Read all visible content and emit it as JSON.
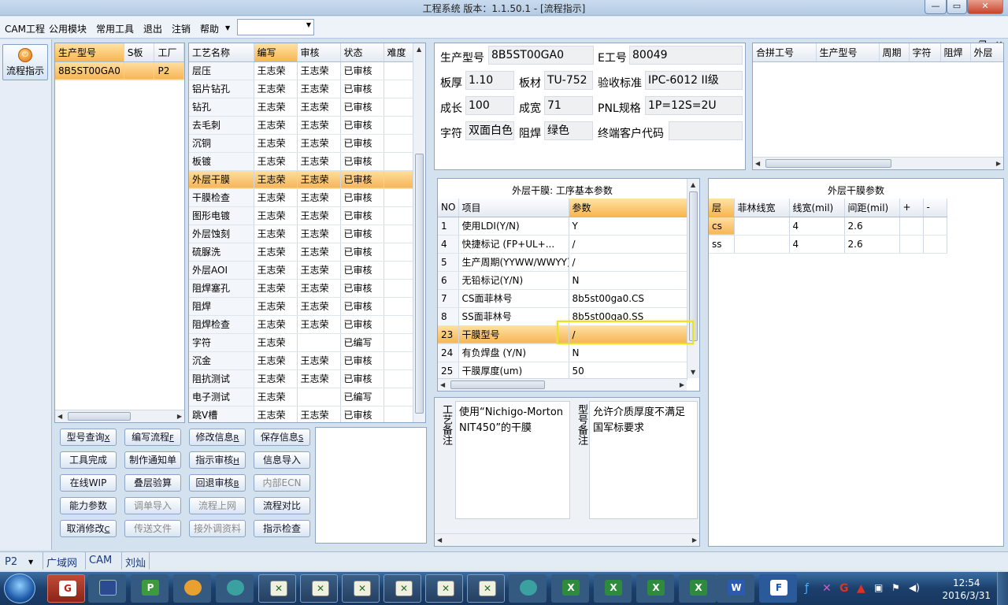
{
  "window": {
    "title": "工程系统   版本：1.1.50.1 - [流程指示]"
  },
  "menu": {
    "items": [
      "CAM工程",
      "公用模块",
      "常用工具",
      "退出",
      "注销",
      "帮助"
    ],
    "dropdown_value": ""
  },
  "leftbar": {
    "flow_label": "流程指示"
  },
  "product_table": {
    "headers": [
      "生产型号",
      "S板",
      "工厂"
    ],
    "rows": [
      [
        "8B5ST00GA0",
        "",
        "P2"
      ]
    ]
  },
  "process_table": {
    "headers": [
      "工艺名称",
      "编写",
      "审核",
      "状态",
      "难度"
    ],
    "rows": [
      [
        "层压",
        "王志荣",
        "王志荣",
        "已审核",
        ""
      ],
      [
        "铝片钻孔",
        "王志荣",
        "王志荣",
        "已审核",
        ""
      ],
      [
        "钻孔",
        "王志荣",
        "王志荣",
        "已审核",
        ""
      ],
      [
        "去毛刺",
        "王志荣",
        "王志荣",
        "已审核",
        ""
      ],
      [
        "沉铜",
        "王志荣",
        "王志荣",
        "已审核",
        ""
      ],
      [
        "板镀",
        "王志荣",
        "王志荣",
        "已审核",
        ""
      ],
      [
        "外层干膜",
        "王志荣",
        "王志荣",
        "已审核",
        ""
      ],
      [
        "干膜检查",
        "王志荣",
        "王志荣",
        "已审核",
        ""
      ],
      [
        "图形电镀",
        "王志荣",
        "王志荣",
        "已审核",
        ""
      ],
      [
        "外层蚀刻",
        "王志荣",
        "王志荣",
        "已审核",
        ""
      ],
      [
        "硫脲洗",
        "王志荣",
        "王志荣",
        "已审核",
        ""
      ],
      [
        "外层AOI",
        "王志荣",
        "王志荣",
        "已审核",
        ""
      ],
      [
        "阻焊塞孔",
        "王志荣",
        "王志荣",
        "已审核",
        ""
      ],
      [
        "阻焊",
        "王志荣",
        "王志荣",
        "已审核",
        ""
      ],
      [
        "阻焊检查",
        "王志荣",
        "王志荣",
        "已审核",
        ""
      ],
      [
        "字符",
        "王志荣",
        "",
        "已编写",
        ""
      ],
      [
        "沉金",
        "王志荣",
        "王志荣",
        "已审核",
        ""
      ],
      [
        "阻抗测试",
        "王志荣",
        "王志荣",
        "已审核",
        ""
      ],
      [
        "电子测试",
        "王志荣",
        "",
        "已编写",
        ""
      ],
      [
        "跳V槽",
        "王志荣",
        "王志荣",
        "已审核",
        ""
      ]
    ]
  },
  "buttons": [
    [
      {
        "label": "型号查询",
        "key": "X",
        "enabled": true
      },
      {
        "label": "编写流程",
        "key": "F",
        "enabled": true
      },
      {
        "label": "修改信息",
        "key": "R",
        "enabled": true
      },
      {
        "label": "保存信息",
        "key": "S",
        "enabled": true
      }
    ],
    [
      {
        "label": "工具完成",
        "key": "",
        "enabled": true
      },
      {
        "label": "制作通知单",
        "key": "",
        "enabled": true
      },
      {
        "label": "指示审核",
        "key": "H",
        "enabled": true
      },
      {
        "label": "信息导入",
        "key": "",
        "enabled": true
      }
    ],
    [
      {
        "label": "在线WIP",
        "key": "",
        "enabled": true
      },
      {
        "label": "叠层验算",
        "key": "",
        "enabled": true
      },
      {
        "label": "回退审核",
        "key": "B",
        "enabled": true
      },
      {
        "label": "内部ECN",
        "key": "",
        "enabled": false
      }
    ],
    [
      {
        "label": "能力参数",
        "key": "",
        "enabled": true
      },
      {
        "label": "调单导入",
        "key": "",
        "enabled": false
      },
      {
        "label": "流程上网",
        "key": "",
        "enabled": false
      },
      {
        "label": "流程对比",
        "key": "",
        "enabled": true
      }
    ],
    [
      {
        "label": "取消修改",
        "key": "C",
        "enabled": true
      },
      {
        "label": "传送文件",
        "key": "",
        "enabled": false
      },
      {
        "label": "接外调资料",
        "key": "",
        "enabled": false
      },
      {
        "label": "指示检查",
        "key": "",
        "enabled": true
      }
    ]
  ],
  "info": {
    "model_label": "生产型号",
    "model_value": "8B5ST00GA0",
    "e_label": "E工号",
    "e_value": "80049",
    "thick_label": "板厚",
    "thick_value": "1.10",
    "material_label": "板材",
    "material_value": "TU-752",
    "std_label": "验收标准",
    "std_value": "IPC-6012 II级",
    "len_label": "成长",
    "len_value": "100",
    "wid_label": "成宽",
    "wid_value": "71",
    "pnl_label": "PNL规格",
    "pnl_value": "1P=12S=2U",
    "char_label": "字符",
    "char_value": "双面白色",
    "mask_label": "阻焊",
    "mask_value": "绿色",
    "cust_label": "终端客户代码",
    "cust_value": ""
  },
  "combine_table": {
    "headers": [
      "合拼工号",
      "生产型号",
      "周期",
      "字符",
      "阻焊",
      "外层"
    ]
  },
  "params": {
    "title": "外层干膜: 工序基本参数",
    "headers": [
      "NO",
      "项目",
      "参数"
    ],
    "rows": [
      [
        "1",
        "使用LDI(Y/N)",
        "Y"
      ],
      [
        "4",
        "快捷标记 (FP+UL+...",
        "/"
      ],
      [
        "5",
        "生产周期(YYWW/WWYY)",
        "/"
      ],
      [
        "6",
        "无铅标记(Y/N)",
        "N"
      ],
      [
        "7",
        "CS面菲林号",
        "8b5st00ga0.CS"
      ],
      [
        "8",
        "SS面菲林号",
        "8b5st00ga0.SS"
      ],
      [
        "23",
        "干膜型号",
        "/"
      ],
      [
        "24",
        "有负焊盘 (Y/N)",
        "N"
      ],
      [
        "25",
        "干膜厚度(um)",
        "50"
      ]
    ]
  },
  "film": {
    "title": "外层干膜参数",
    "headers": [
      "层",
      "菲林线宽",
      "线宽(mil)",
      "间距(mil)",
      "+",
      "-"
    ],
    "rows": [
      [
        "cs",
        "",
        "4",
        "2.6",
        "",
        ""
      ],
      [
        "ss",
        "",
        "4",
        "2.6",
        "",
        ""
      ]
    ]
  },
  "remarks": {
    "process_label": "工艺备注",
    "process_text": "使用“Nichigo-Morton NIT450”的干膜",
    "model_label": "型号备注",
    "model_text": "允许介质厚度不满足国军标要求"
  },
  "status": {
    "factory": "P2",
    "network": "广域网",
    "system": "CAM",
    "user": "刘灿"
  },
  "clock": {
    "time": "12:54",
    "date": "2016/3/31"
  }
}
